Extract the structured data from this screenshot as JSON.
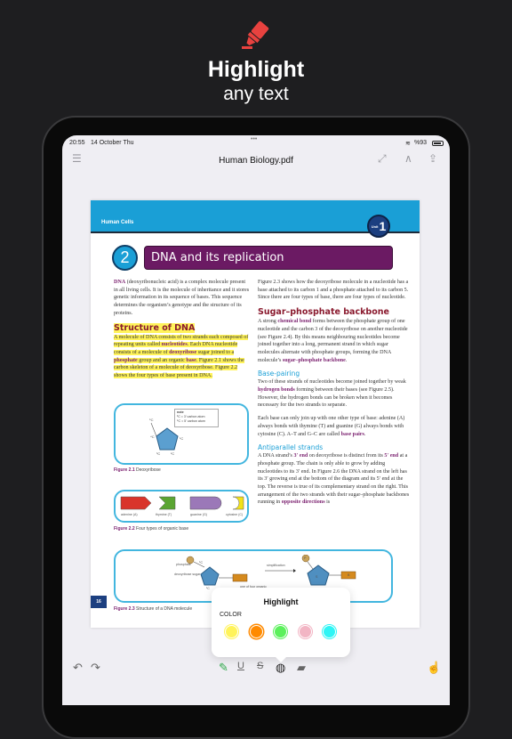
{
  "promo": {
    "title": "Highlight",
    "subtitle": "any text",
    "icon": "highlighter-marker-icon",
    "icon_color": "#e8423f"
  },
  "status": {
    "time": "20:55",
    "date": "14 October Thu",
    "battery": "%93"
  },
  "toolbar": {
    "title": "Human Biology.pdf"
  },
  "page": {
    "section": "Human Cells",
    "unit_label": "Unit",
    "unit_num": "1",
    "chapter_num": "2",
    "chapter_title": "DNA and its replication",
    "page_number": "16",
    "left": [
      {
        "type": "p",
        "segs": [
          {
            "t": "DNA",
            "k": 1
          },
          {
            "t": " (deoxyribonucleic acid) is a complex molecule present in all living cells. It is the molecule of inheritance and it stores genetic information in its sequence of bases. This sequence determines the organism’s genotype and the structure of its proteins."
          }
        ]
      },
      {
        "type": "h2",
        "hl": 1,
        "segs": [
          {
            "t": "Structure of DNA"
          }
        ]
      },
      {
        "type": "p",
        "hl": 1,
        "segs": [
          {
            "t": "A molecule of DNA consists of two strands each composed of repeating units called "
          },
          {
            "t": "nucleotides",
            "k": 1
          },
          {
            "t": ". Each DNA nucleotide consists of a molecule of "
          },
          {
            "t": "deoxyribose",
            "k": 1
          },
          {
            "t": " sugar joined to a "
          },
          {
            "t": "phosphate",
            "k": 1
          },
          {
            "t": " group and an organic "
          },
          {
            "t": "base",
            "k": 1
          },
          {
            "t": ". Figure 2.1 shows the carbon skeleton of a molecule of deoxyribose. Figure 2.2 shows the four types of base present in DNA."
          }
        ]
      }
    ],
    "right": [
      {
        "type": "p",
        "segs": [
          {
            "t": "Figure 2.3 shows how the deoxyribose molecule in a nucleotide has a base attached to its carbon 1 and a phosphate attached to its carbon 5. Since there are four types of base, there are four types of nucleotide."
          }
        ]
      },
      {
        "type": "h2",
        "segs": [
          {
            "t": "Sugar–phosphate backbone"
          }
        ]
      },
      {
        "type": "p",
        "segs": [
          {
            "t": "A strong "
          },
          {
            "t": "chemical bond",
            "k": 1
          },
          {
            "t": " forms between the phosphate group of one nucleotide and the carbon 3 of the deoxyribose on another nucleotide (see Figure 2.4). By this means neighbouring nucleotides become joined together into a long, permanent strand in which sugar molecules alternate with phosphate groups, forming the DNA molecule’s "
          },
          {
            "t": "sugar–phosphate backbone",
            "k": 1
          },
          {
            "t": "."
          }
        ]
      },
      {
        "type": "h3",
        "segs": [
          {
            "t": "Base-pairing"
          }
        ]
      },
      {
        "type": "p",
        "segs": [
          {
            "t": "Two of these strands of nucleotides become joined together by weak "
          },
          {
            "t": "hydrogen bonds",
            "k": 1
          },
          {
            "t": " forming between their bases (see Figure 2.5). However, the hydrogen bonds can be broken when it becomes necessary for the two strands to separate."
          }
        ]
      },
      {
        "type": "p",
        "segs": [
          {
            "t": "Each base can only join up with one other type of base: adenine (A) always bonds with thymine (T) and guanine (G) always bonds with cytosine (C). A–T and G–C are called "
          },
          {
            "t": "base pairs",
            "k": 1
          },
          {
            "t": "."
          }
        ]
      },
      {
        "type": "h3",
        "segs": [
          {
            "t": "Antiparallel strands"
          }
        ]
      },
      {
        "type": "p",
        "segs": [
          {
            "t": "A DNA strand’s "
          },
          {
            "t": "3′ end",
            "k": 1
          },
          {
            "t": " on deoxyribose is distinct from its "
          },
          {
            "t": "5′ end",
            "k": 1
          },
          {
            "t": " at a phosphate group. The chain is only able to grow by adding nucleotides to its 3′ end. In Figure 2.6 the DNA strand on the left has its 3′ growing end at the bottom of the diagram and its 5′ end at the top. The reverse is true of its complementary strand on the right. This arrangement of the two strands with their sugar–phosphate backbones running in "
          },
          {
            "t": "opposite directions",
            "k": 1
          },
          {
            "t": " is"
          }
        ]
      }
    ],
    "fig1": {
      "note_title": "note",
      "note1": "³C = 3′ carbon atom",
      "note2": "⁵C = 5′ carbon atom",
      "cap_num": "Figure 2.1",
      "cap": " Deoxyribose",
      "labels": [
        "⁵C",
        "⁴C",
        "¹C",
        "³C",
        "²C"
      ]
    },
    "fig2": {
      "cap_num": "Figure 2.2",
      "cap": " Four types of organic base",
      "bases": [
        {
          "label": "adenine (A)",
          "color": "#d9342b"
        },
        {
          "label": "thymine (T)",
          "color": "#5aa532"
        },
        {
          "label": "guanine (G)",
          "color": "#9b78b8"
        },
        {
          "label": "cytosine (C)",
          "color": "#f2e21b"
        }
      ]
    },
    "fig3": {
      "phosphate": "phosphate",
      "sugar": "deoxyribose sugar",
      "bases": "one of four organic bases",
      "arrow": "simplification",
      "p_eq": "P = phosphate",
      "p": "P",
      "s": "S",
      "b": "B",
      "c5": "⁵C",
      "c1": "¹C",
      "cap_num": "Figure 2.3",
      "cap": " Structure of a DNA molecule"
    }
  },
  "popup": {
    "title": "Highlight",
    "color_label": "COLOR",
    "colors": [
      "#fff35a",
      "#ff8a00",
      "#5cf05c",
      "#f2b5c4",
      "#2ef5f5"
    ],
    "selected": "#ff8a00"
  },
  "bottom": {
    "tools": [
      "undo-icon",
      "redo-icon",
      "highlighter-pen-icon",
      "underline-icon",
      "strikethrough-icon",
      "palette-icon",
      "eraser-icon",
      "hand-pointer-icon"
    ],
    "pen_color": "#2ea84a"
  }
}
